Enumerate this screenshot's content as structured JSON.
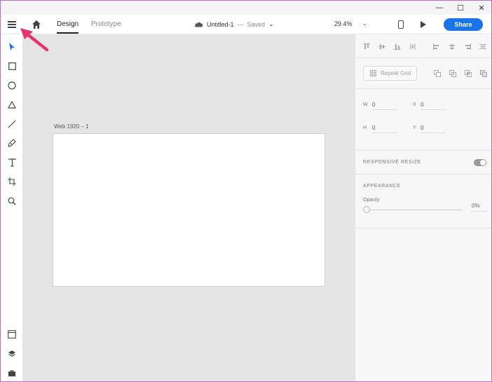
{
  "titlebar": {
    "minimize": "—",
    "maximize": "☐",
    "close": "✕"
  },
  "appbar": {
    "tabs": [
      {
        "label": "Design"
      },
      {
        "label": "Prototype"
      }
    ],
    "document": {
      "name": "Untitled-1",
      "separator": "—",
      "status": "Saved",
      "caret": "⌄"
    },
    "zoom": "29.4%",
    "zoom_caret": "⌄",
    "share_label": "Share"
  },
  "toolbar": {
    "tools": [
      "select-icon",
      "rectangle-icon",
      "ellipse-icon",
      "triangle-icon",
      "line-icon",
      "pen-icon",
      "text-icon",
      "artboard-icon",
      "zoom-icon"
    ],
    "bottom": [
      "assets-icon",
      "layers-icon",
      "plugins-icon"
    ]
  },
  "canvas": {
    "artboard_label": "Web 1920 – 1"
  },
  "panel": {
    "repeat_grid_label": "Repeat Grid",
    "dims": {
      "w_label": "W",
      "w_value": "0",
      "h_label": "H",
      "h_value": "0",
      "x_label": "X",
      "x_value": "0",
      "y_label": "Y",
      "y_value": "0"
    },
    "responsive_resize": "RESPONSIVE RESIZE",
    "appearance": "APPEARANCE",
    "opacity_label": "Opacity",
    "opacity_value": "0%"
  },
  "colors": {
    "accent": "#1a73e8",
    "annotation": "#e8336d"
  }
}
